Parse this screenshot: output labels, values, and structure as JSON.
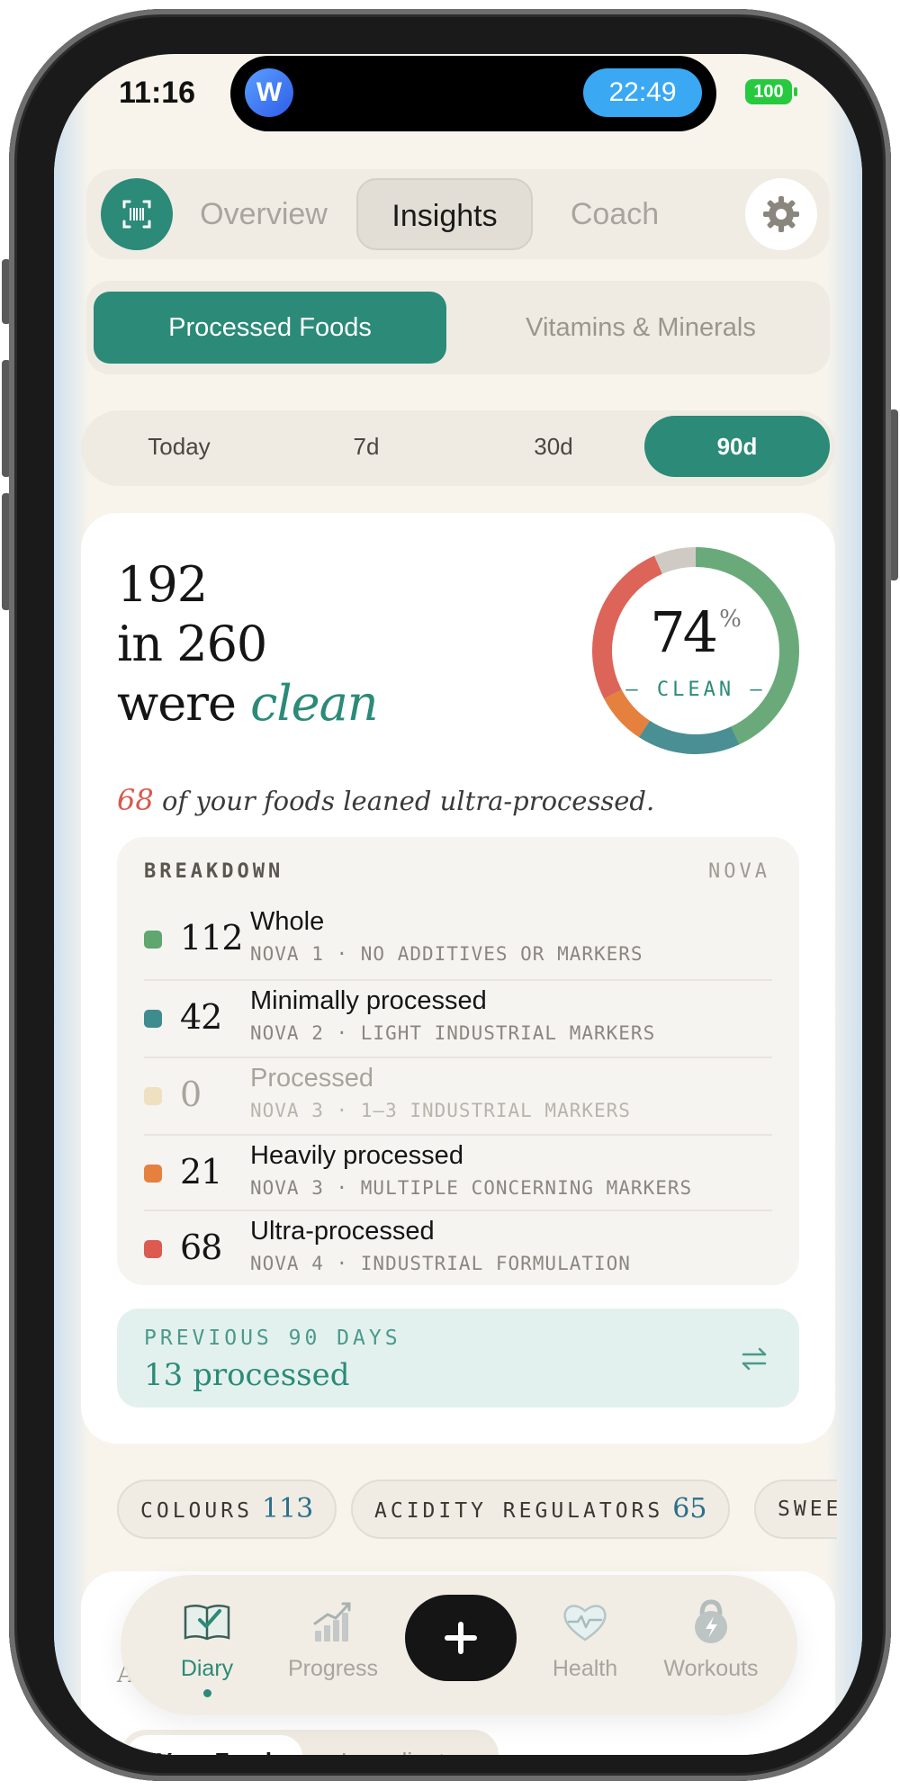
{
  "status_bar": {
    "time": "11:16",
    "avatar_letter": "W",
    "timer": "22:49",
    "battery": "100"
  },
  "top_nav": {
    "tabs": [
      "Overview",
      "Insights",
      "Coach"
    ],
    "active": "Insights"
  },
  "segment": {
    "options": [
      "Processed Foods",
      "Vitamins & Minerals"
    ],
    "active": "Processed Foods"
  },
  "range": {
    "options": [
      "Today",
      "7d",
      "30d",
      "90d"
    ],
    "active": "90d"
  },
  "summary": {
    "line1": "192",
    "line2": "in 260",
    "line3_prefix": "were",
    "line3_emphasis": "clean",
    "percent": "74",
    "percent_sign": "%",
    "donut_label": "CLEAN",
    "ultra_count": "68",
    "ultra_text": "of your foods leaned ultra-processed.",
    "donut_segments": [
      {
        "name": "Whole",
        "value": 112,
        "color": "#6aaa7a"
      },
      {
        "name": "Minimally processed",
        "value": 42,
        "color": "#4a8f93"
      },
      {
        "name": "Heavily processed",
        "value": 21,
        "color": "#e5803f"
      },
      {
        "name": "Ultra-processed",
        "value": 68,
        "color": "#dc6458"
      },
      {
        "name": "Other",
        "value": 17,
        "color": "#cfcbc4"
      }
    ]
  },
  "breakdown": {
    "title": "BREAKDOWN",
    "scale": "NOVA",
    "rows": [
      {
        "count": "112",
        "title": "Whole",
        "sub": "NOVA 1 · NO ADDITIVES OR MARKERS",
        "color": "#5fa66f",
        "muted": false
      },
      {
        "count": "42",
        "title": "Minimally processed",
        "sub": "NOVA 2 · LIGHT INDUSTRIAL MARKERS",
        "color": "#3f8c8f",
        "muted": false
      },
      {
        "count": "0",
        "title": "Processed",
        "sub": "NOVA 3 · 1–3 INDUSTRIAL MARKERS",
        "color": "#efe0c2",
        "muted": true
      },
      {
        "count": "21",
        "title": "Heavily processed",
        "sub": "NOVA 3 · MULTIPLE CONCERNING MARKERS",
        "color": "#e5803f",
        "muted": false
      },
      {
        "count": "68",
        "title": "Ultra-processed",
        "sub": "NOVA 4 · INDUSTRIAL FORMULATION",
        "color": "#dc5a50",
        "muted": false
      }
    ]
  },
  "previous": {
    "label": "PREVIOUS 90 DAYS",
    "value": "13 processed"
  },
  "chips": [
    {
      "label": "COLOURS",
      "count": "113"
    },
    {
      "label": "ACIDITY REGULATORS",
      "count": "65"
    },
    {
      "label": "SWEE",
      "count": ""
    }
  ],
  "lower_card": {
    "subtitle": "A",
    "tabs": [
      "Your Food",
      "Ingredients"
    ],
    "active": "Your Food"
  },
  "tab_bar": {
    "items": [
      {
        "label": "Diary",
        "icon": "book-icon",
        "active": true
      },
      {
        "label": "Progress",
        "icon": "chart-icon",
        "active": false
      },
      {
        "label": "Health",
        "icon": "heart-icon",
        "active": false
      },
      {
        "label": "Workouts",
        "icon": "kettlebell-icon",
        "active": false
      }
    ],
    "add_icon": "plus-icon"
  },
  "colors": {
    "accent": "#2b8a78",
    "danger": "#dc5a50",
    "background": "#f8f4ec"
  }
}
